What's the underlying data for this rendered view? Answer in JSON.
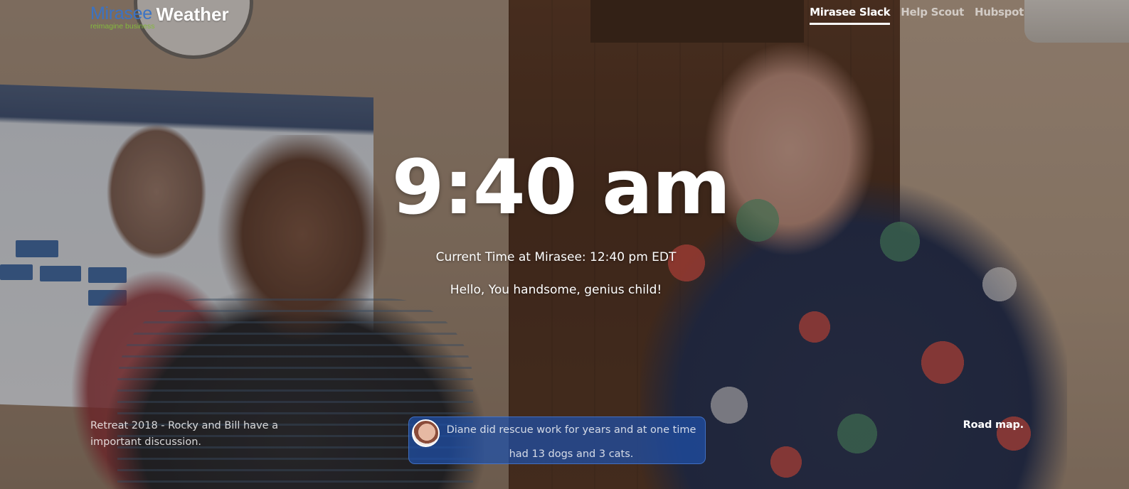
{
  "brand": {
    "logo_name": "Mirasee",
    "logo_tagline": "reimagine business",
    "title": "Weather"
  },
  "nav": {
    "items": [
      {
        "label": "Mirasee Slack",
        "active": true
      },
      {
        "label": "Help Scout",
        "active": false
      },
      {
        "label": "Hubspot",
        "active": false
      }
    ]
  },
  "main": {
    "local_time": "9:40 am",
    "mirasee_time": "Current Time at Mirasee: 12:40 pm EDT",
    "greeting": "Hello, You handsome, genius child!"
  },
  "footer": {
    "photo_caption": "Retreat 2018 - Rocky and Bill have a important discussion.",
    "fact": "Diane did rescue work for years and at one time had 13 dogs and 3 cats.",
    "roadmap_label": "Road map."
  },
  "colors": {
    "logo_blue": "#3b73c4",
    "logo_green": "#84b93e",
    "fact_box": "#1e50aa"
  }
}
